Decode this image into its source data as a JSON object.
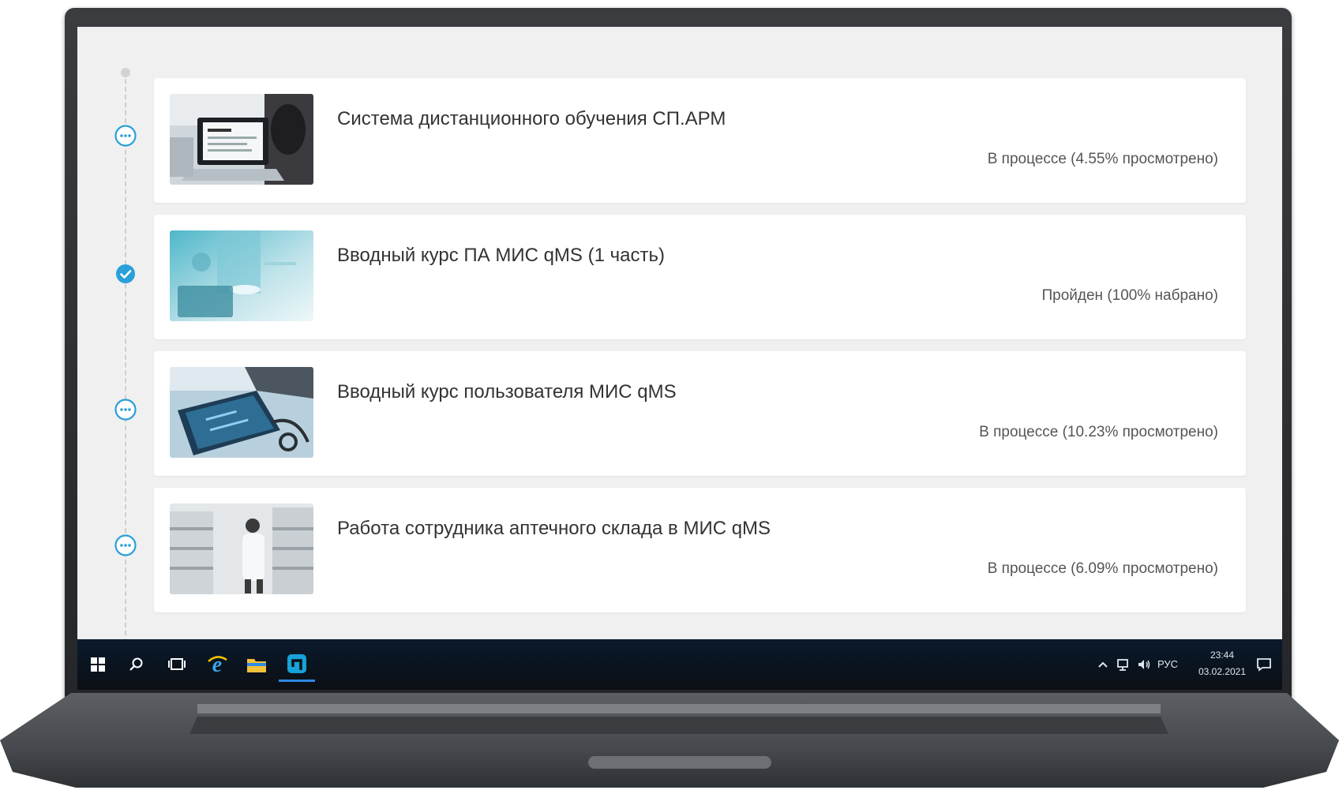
{
  "courses": [
    {
      "title": "Система дистанционного обучения СП.АРМ",
      "status": "В процессе (4.55% просмотрено)",
      "state": "in-progress",
      "progress_percent": 4.55
    },
    {
      "title": "Вводный курс ПА МИС qMS (1 часть)",
      "status": "Пройден (100% набрано)",
      "state": "completed",
      "progress_percent": 100
    },
    {
      "title": "Вводный курс пользователя МИС qMS",
      "status": "В процессе (10.23% просмотрено)",
      "state": "in-progress",
      "progress_percent": 10.23
    },
    {
      "title": "Работа сотрудника аптечного склада в МИС qMS",
      "status": "В процессе (6.09% просмотрено)",
      "state": "in-progress",
      "progress_percent": 6.09
    }
  ],
  "icons": {
    "in_progress": "more-horizontal-circle-icon",
    "completed": "check-circle-icon"
  },
  "taskbar": {
    "apps": [
      "windows-start-icon",
      "search-icon",
      "task-view-icon",
      "internet-explorer-icon",
      "file-explorer-icon",
      "app-icon"
    ],
    "language": "РУС",
    "time": "23:44",
    "date": "03.02.2021"
  },
  "colors": {
    "accent": "#2b9fd9",
    "card_background": "#ffffff",
    "screen_background": "#f0f0f0",
    "text": "#333333",
    "taskbar": "#0b0f14"
  }
}
